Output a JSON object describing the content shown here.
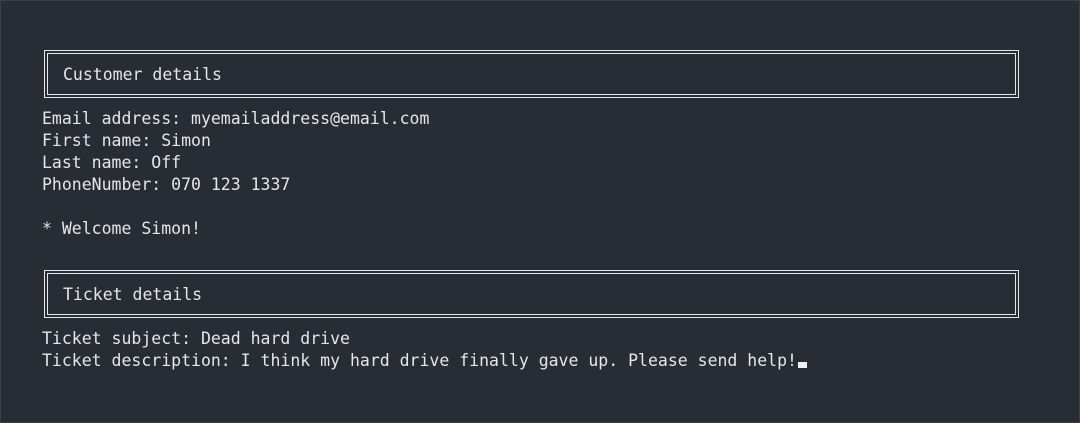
{
  "customer_section": {
    "title": "Customer details",
    "email": "Email address: myemailaddress@email.com",
    "first_name": "First name: Simon",
    "last_name": "Last name: Off",
    "phone": "PhoneNumber: 070 123 1337",
    "welcome": "* Welcome Simon!"
  },
  "ticket_section": {
    "title": "Ticket details",
    "subject": "Ticket subject: Dead hard drive",
    "description": "Ticket description: I think my hard drive finally gave up. Please send help!"
  },
  "colors": {
    "background": "#282c34",
    "foreground": "#e6e6e6"
  }
}
